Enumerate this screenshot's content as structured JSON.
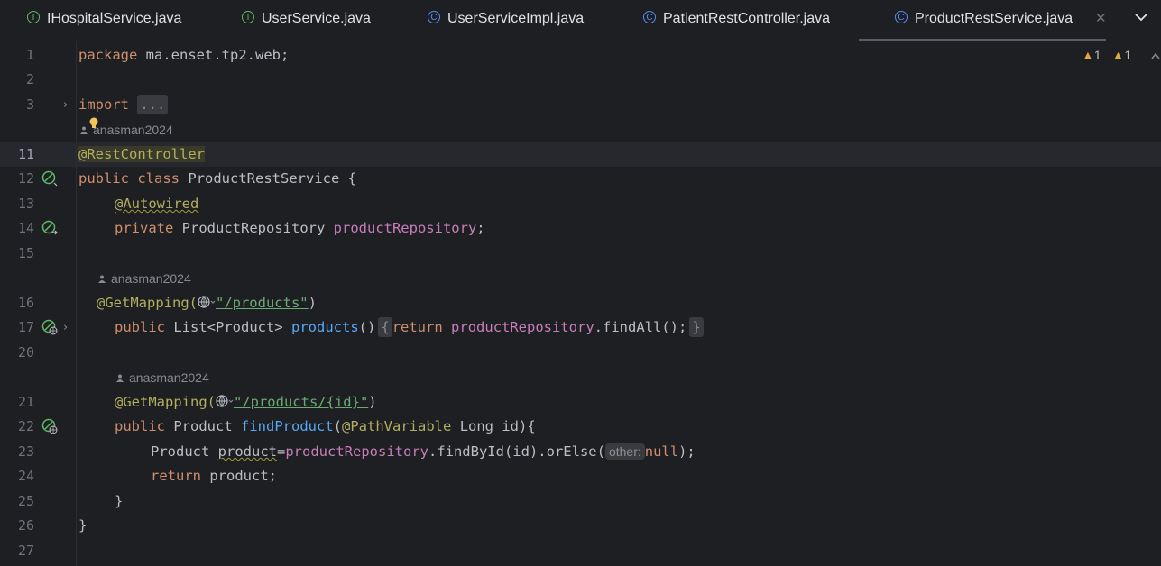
{
  "tabs": [
    {
      "name": "IHospitalService.java",
      "kind": "interface",
      "icon": "I"
    },
    {
      "name": "UserService.java",
      "kind": "interface",
      "icon": "I"
    },
    {
      "name": "UserServiceImpl.java",
      "kind": "class",
      "icon": "C"
    },
    {
      "name": "PatientRestController.java",
      "kind": "class",
      "icon": "C"
    },
    {
      "name": "ProductRestService.java",
      "kind": "class",
      "icon": "C",
      "active": true
    }
  ],
  "gutter": {
    "line_numbers": [
      "1",
      "2",
      "3",
      "11",
      "12",
      "13",
      "14",
      "15",
      "16",
      "17",
      "20",
      "21",
      "22",
      "23",
      "24",
      "25",
      "26",
      "27"
    ]
  },
  "inspections": {
    "warnings_a": "1",
    "warnings_b": "1"
  },
  "authors": [
    "anasman2024",
    "anasman2024",
    "anasman2024"
  ],
  "code": {
    "package_kw": "package",
    "package_name": "ma.enset.tp2.web;",
    "import_kw": "import",
    "import_fold": "...",
    "rest_controller": "@RestController",
    "public_kw": "public",
    "class_kw": "class",
    "class_name": "ProductRestService {",
    "autowired": "@Autowired",
    "private_kw": "private",
    "repo_type": "ProductRepository",
    "repo_field": "productRepository",
    "semicolon": ";",
    "getmapping": "@GetMapping(",
    "products_path": "\"/products\"",
    "close_paren": ")",
    "list_type": "List<Product>",
    "products_fn": "products",
    "parens": "()",
    "fold_open": "{",
    "return_kw": "return",
    "repo_ref": "productRepository",
    "find_all": ".findAll();",
    "fold_close": "}",
    "product_id_path": "\"/products/{id}\"",
    "product_type": "Product",
    "find_product_fn": "findProduct",
    "path_variable": "@PathVariable",
    "param": "Long id){",
    "local_type": "Product",
    "local_var": "product",
    "assign": "=",
    "find_by_id": ".findById(id).orElse(",
    "hint_other": "other:",
    "null_kw": "null",
    "end_call": ");",
    "return_product": "product;",
    "close_brace": "}",
    "class_close": "}"
  },
  "colors": {
    "background": "#1e1f22",
    "keyword": "#cf8e6d",
    "annotation": "#b3ae60",
    "field": "#c77dbb",
    "function": "#56a8f5",
    "string": "#6aab73"
  },
  "icons": [
    "interface-icon",
    "class-icon",
    "close-icon",
    "chevron-down-icon",
    "warning-icon",
    "bulb-icon",
    "bean-icon",
    "web-endpoint-icon",
    "globe-icon",
    "person-icon",
    "fold-chevron-icon"
  ]
}
